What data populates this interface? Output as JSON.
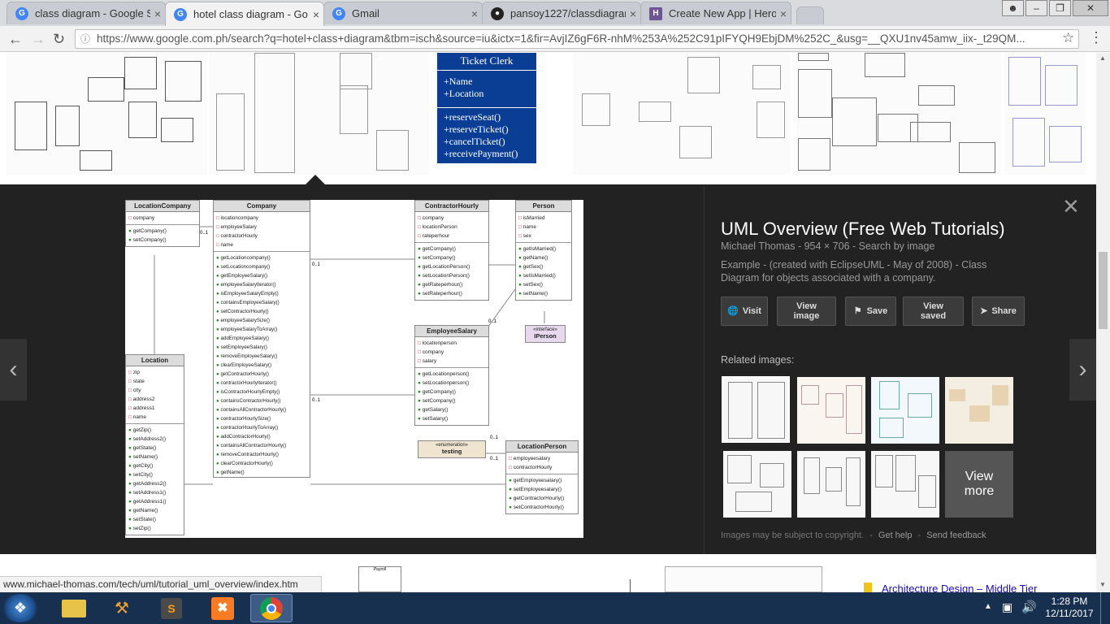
{
  "tabs": [
    {
      "title": "class diagram - Google S",
      "icon": "google-icon",
      "color": "#4285f4"
    },
    {
      "title": "hotel class diagram - Go",
      "icon": "google-icon",
      "color": "#4285f4"
    },
    {
      "title": "Gmail",
      "icon": "google-icon",
      "color": "#4285f4"
    },
    {
      "title": "pansoy1227/classdiagran",
      "icon": "github-icon",
      "color": "#222222"
    },
    {
      "title": "Create New App | Heroku",
      "icon": "heroku-icon",
      "color": "#6e5596"
    }
  ],
  "address": {
    "url": "https://www.google.com.ph/search?q=hotel+class+diagram&tbm=isch&source=iu&ictx=1&fir=AvjIZ6gF6R-nhM%253A%252C91pIFYQH9EbjDM%252C_&usg=__QXU1nv45amw_iix-_t29QM..."
  },
  "strip": {
    "ticket_clerk": {
      "title": "Ticket Clerk",
      "attrs": [
        "+Name",
        "+Location"
      ],
      "methods": [
        "+reserveSeat()",
        "+reserveTicket()",
        "+cancelTicket()",
        "+receivePayment()"
      ]
    }
  },
  "diagram": {
    "classes": {
      "location_company": {
        "name": "LocationCompany",
        "attrs": [
          "company"
        ],
        "methods": [
          "getCompany()",
          "setCompany()"
        ]
      },
      "company": {
        "name": "Company",
        "attrs": [
          "locationcompany",
          "employeeSalary",
          "contractorHourly",
          "name"
        ],
        "methods": [
          "getLocationcompany()",
          "setLocationcompany()",
          "getEmployeeSalary()",
          "employeeSalaryIterator()",
          "isEmployeeSalaryEmpty()",
          "containsEmployeeSalary()",
          "setContractorHourly()",
          "employeeSalarySize()",
          "employeeSalaryToArray()",
          "addEmployeeSalary()",
          "setEmployeeSalary()",
          "removeEmployeeSalary()",
          "clearEmployeeSalary()",
          "getContractorHourly()",
          "contractorHourlyIterator()",
          "isContractorHourlyEmpty()",
          "containsContractorHourly()",
          "containsAllContractorHourly()",
          "contractorHourlySize()",
          "contractorHourlyToArray()",
          "addContractorHourly()",
          "containsAllContractorHourly()",
          "removeContractorHourly()",
          "clearContractorHourly()",
          "getName()"
        ]
      },
      "contractor_hourly": {
        "name": "ContractorHourly",
        "attrs": [
          "company",
          "locationPerson",
          "rateperhour"
        ],
        "methods": [
          "getCompany()",
          "setCompany()",
          "getLocationPerson()",
          "setLocationPerson()",
          "getRateperhour()",
          "setRateperhour()"
        ]
      },
      "person": {
        "name": "Person",
        "attrs": [
          "isMarried",
          "name",
          "sex"
        ],
        "methods": [
          "getIsMarried()",
          "getName()",
          "getSex()",
          "setIsMarried()",
          "setSex()",
          "setName()"
        ]
      },
      "employee_salary": {
        "name": "EmployeeSalary",
        "attrs": [
          "locationperson",
          "company",
          "salary"
        ],
        "methods": [
          "getLocationperson()",
          "setLocationperson()",
          "getCompany()",
          "setCompany()",
          "getSalary()",
          "setSalary()"
        ]
      },
      "location": {
        "name": "Location",
        "attrs": [
          "zip",
          "state",
          "city",
          "address2",
          "address1",
          "name"
        ],
        "methods": [
          "getZip()",
          "setAddress2()",
          "getState()",
          "setName()",
          "getCity()",
          "setCity()",
          "getAddress2()",
          "setAddress1()",
          "getAddress1()",
          "getName()",
          "setState()",
          "setZip()"
        ]
      },
      "location_person": {
        "name": "LocationPerson",
        "attrs": [
          "employeesalary",
          "contractorHourly"
        ],
        "methods": [
          "getEmployeesalary()",
          "setEmployeesalary()",
          "getContractorHourly()",
          "setContractorHourly()"
        ]
      }
    },
    "iperson": {
      "stereotype": "«interface»",
      "name": "IPerson"
    },
    "testing": {
      "stereotype": "«enumeration»",
      "name": "testing"
    },
    "mults": [
      "0..1",
      "0..1",
      "0..1",
      "0..1",
      "0..1",
      "0..1",
      "0..1"
    ]
  },
  "info": {
    "title": "UML Overview (Free Web Tutorials)",
    "meta": "Michael Thomas  -  954 × 706  -  Search by image",
    "description": "Example - (created with EclipseUML - May of 2008) - Class Diagram for objects associated with a company.",
    "buttons": {
      "visit": "Visit",
      "view_image": "View image",
      "save": "Save",
      "view_saved": "View saved",
      "share": "Share"
    },
    "related_label": "Related images:",
    "view_more": "View more",
    "footer_note": "Images may be subject to copyright.",
    "get_help": "Get help",
    "send_feedback": "Send feedback"
  },
  "bottom": {
    "payroll": "Payroll",
    "architecture": "Architecture Design – Middle Tier"
  },
  "status_url": "www.michael-thomas.com/tech/uml/tutorial_uml_overview/index.htm",
  "tray": {
    "time": "1:28 PM",
    "date": "12/11/2017"
  },
  "colors": {
    "panel_bg": "#222222",
    "ticket_clerk": "#0a3e94",
    "taskbar": "#17304f"
  }
}
